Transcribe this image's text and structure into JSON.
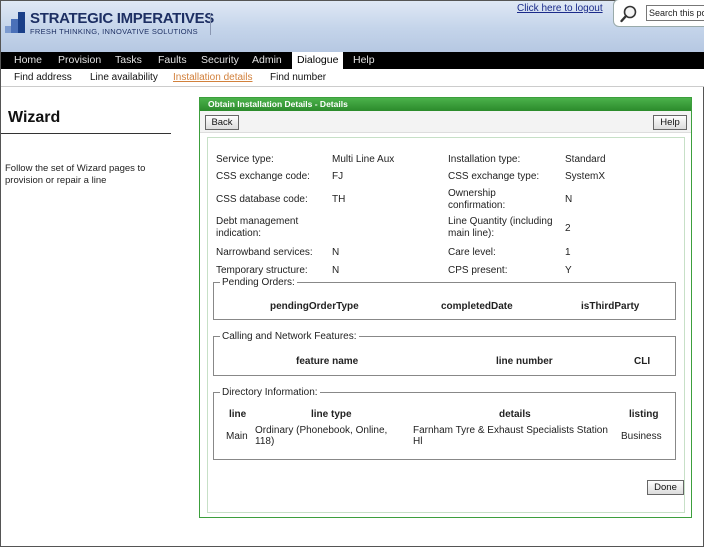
{
  "header": {
    "logo_name": "STRATEGIC IMPERATIVES",
    "logo_tagline": "FRESH THINKING, INNOVATIVE SOLUTIONS",
    "logout_link": "Click here to logout",
    "search_value": "Search this po",
    "search_icon": "magnifier-icon"
  },
  "colors": {
    "brand": "#1d2f63",
    "nav_bg": "#000000",
    "panel_green": "#2f9a2f",
    "active_subnav": "#d2813c"
  },
  "nav": {
    "items": [
      "Home",
      "Provision",
      "Tasks",
      "Faults",
      "Security",
      "Admin",
      "Dialogue",
      "Help"
    ],
    "active": "Dialogue"
  },
  "subnav": {
    "items": [
      "Find address",
      "Line availability",
      "Installation details",
      "Find number"
    ],
    "active": "Installation details"
  },
  "sidebar": {
    "title": "Wizard",
    "description": "Follow the set of Wizard pages to provision or repair a line"
  },
  "panel": {
    "title": "Obtain Installation Details - Details",
    "back_label": "Back",
    "help_label": "Help",
    "done_label": "Done",
    "fields": {
      "service_type_label": "Service type:",
      "service_type_value": "Multi Line Aux",
      "installation_type_label": "Installation type:",
      "installation_type_value": "Standard",
      "css_exchange_code_label": "CSS exchange code:",
      "css_exchange_code_value": "FJ",
      "css_exchange_type_label": "CSS exchange type:",
      "css_exchange_type_value": "SystemX",
      "css_database_code_label": "CSS database code:",
      "css_database_code_value": "TH",
      "ownership_label": "Ownership confirmation:",
      "ownership_value": "N",
      "debt_label": "Debt management indication:",
      "debt_value": "",
      "line_quantity_label": "Line Quantity (including main line):",
      "line_quantity_value": "2",
      "narrowband_label": "Narrowband services:",
      "narrowband_value": "N",
      "care_level_label": "Care level:",
      "care_level_value": "1",
      "temporary_label": "Temporary structure:",
      "temporary_value": "N",
      "cps_label": "CPS present:",
      "cps_value": "Y"
    },
    "pending_orders": {
      "legend": "Pending Orders:",
      "columns": [
        "pendingOrderType",
        "completedDate",
        "isThirdParty"
      ]
    },
    "calling_features": {
      "legend": "Calling and Network Features:",
      "columns": [
        "feature name",
        "line number",
        "CLI"
      ]
    },
    "directory": {
      "legend": "Directory Information:",
      "columns": [
        "line",
        "line type",
        "details",
        "listing"
      ],
      "rows": [
        {
          "line": "Main",
          "line_type": "Ordinary (Phonebook, Online, 118)",
          "details": "Farnham Tyre & Exhaust Specialists Station Hl",
          "listing": "Business"
        }
      ]
    }
  }
}
